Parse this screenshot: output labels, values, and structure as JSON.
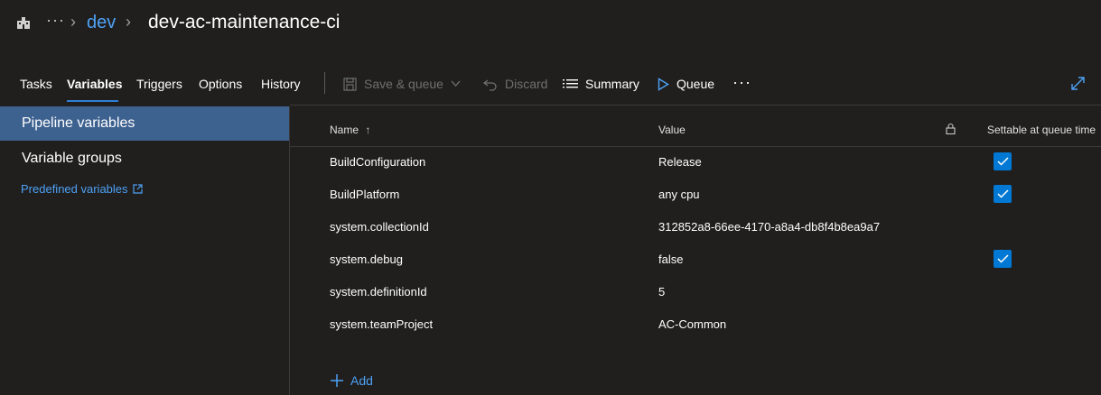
{
  "breadcrumb": {
    "ellipsis": "···",
    "parent": "dev",
    "title": "dev-ac-maintenance-ci"
  },
  "tabs": [
    {
      "label": "Tasks"
    },
    {
      "label": "Variables",
      "active": true
    },
    {
      "label": "Triggers"
    },
    {
      "label": "Options"
    },
    {
      "label": "History"
    }
  ],
  "toolbar": {
    "save_queue": "Save & queue",
    "discard": "Discard",
    "summary": "Summary",
    "queue": "Queue",
    "more": "···"
  },
  "sidebar": {
    "items": [
      {
        "label": "Pipeline variables",
        "selected": true
      },
      {
        "label": "Variable groups"
      }
    ],
    "predefined_link": "Predefined variables"
  },
  "grid": {
    "headers": {
      "name": "Name",
      "sort_indicator": "↑",
      "value": "Value",
      "settable": "Settable at queue time"
    },
    "rows": [
      {
        "name": "BuildConfiguration",
        "value": "Release",
        "settable": true
      },
      {
        "name": "BuildPlatform",
        "value": "any cpu",
        "settable": true
      },
      {
        "name": "system.collectionId",
        "value": "312852a8-66ee-4170-a8a4-db8f4b8ea9a7",
        "settable": false
      },
      {
        "name": "system.debug",
        "value": "false",
        "settable": true
      },
      {
        "name": "system.definitionId",
        "value": "5",
        "settable": false
      },
      {
        "name": "system.teamProject",
        "value": "AC-Common",
        "settable": false
      }
    ]
  },
  "add_label": "Add",
  "colors": {
    "background": "#201f1e",
    "accent": "#0078d4",
    "link": "#4ea1f5",
    "selected": "#3e6290"
  }
}
